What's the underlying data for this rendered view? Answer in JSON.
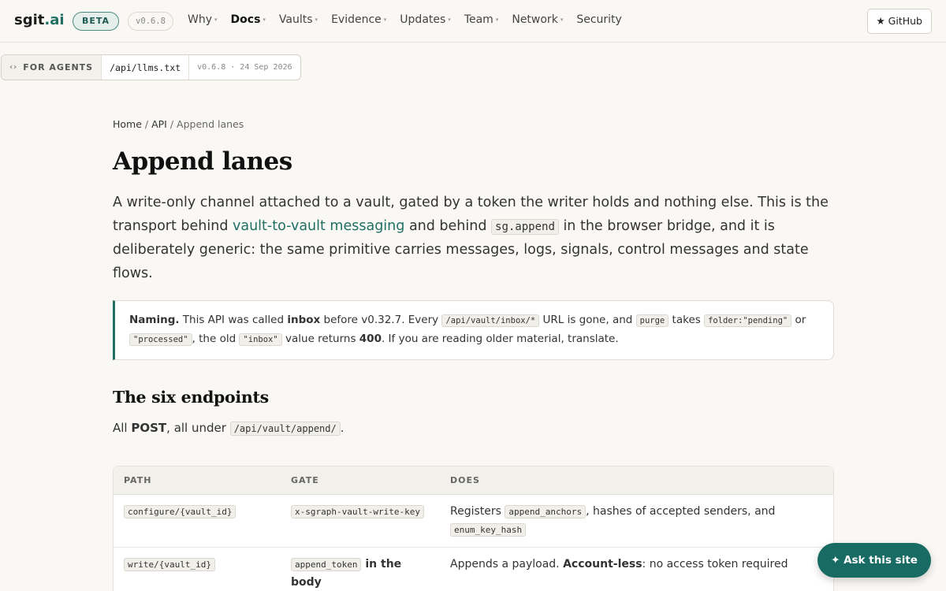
{
  "header": {
    "logo_main": "sgit",
    "logo_tld": ".ai",
    "beta": "BETA",
    "version": "v0.6.8",
    "nav": [
      {
        "label": "Why",
        "caret": "▾"
      },
      {
        "label": "Docs",
        "caret": "▾"
      },
      {
        "label": "Vaults",
        "caret": "▾"
      },
      {
        "label": "Evidence",
        "caret": "▾"
      },
      {
        "label": "Updates",
        "caret": "▾"
      },
      {
        "label": "Team",
        "caret": "▾"
      },
      {
        "label": "Network",
        "caret": "▾"
      },
      {
        "label": "Security",
        "caret": ""
      }
    ],
    "github": "★ GitHub"
  },
  "agents": {
    "chevron": "‹›",
    "label": "FOR AGENTS",
    "path": "/api/llms.txt",
    "meta": "v0.6.8 · 24 Sep 2026"
  },
  "breadcrumb": {
    "home": "Home",
    "sep1": " / ",
    "api": "API",
    "sep2": " / ",
    "current": "Append lanes"
  },
  "title": "Append lanes",
  "lead": {
    "p1": "A write-only channel attached to a vault, gated by a token the writer holds and nothing else. This is the transport behind ",
    "link": "vault-to-vault messaging",
    "p2": " and behind ",
    "code": "sg.append",
    "p3": " in the browser bridge, and it is deliberately generic: the same primitive carries messages, logs, signals, control messages and state flows."
  },
  "callout": {
    "lead": "Naming.",
    "t1": " This API was called ",
    "b1": "inbox",
    "t2": " before v0.32.7. Every ",
    "c1": "/api/vault/inbox/*",
    "t3": " URL is gone, and ",
    "c2": "purge",
    "t4": " takes ",
    "c3": "folder:\"pending\"",
    "t5": " or ",
    "c4": "\"processed\"",
    "t6": ", the old ",
    "c5": "\"inbox\"",
    "t7": " value returns ",
    "b2": "400",
    "t8": ". If you are reading older material, translate."
  },
  "section": {
    "heading": "The six endpoints",
    "t1": "All ",
    "b1": "POST",
    "t2": ", all under ",
    "c1": "/api/vault/append/",
    "t3": "."
  },
  "table": {
    "headers": [
      "PATH",
      "GATE",
      "DOES"
    ],
    "rows": [
      {
        "path": "configure/{vault_id}",
        "gate_code": "x-sgraph-vault-write-key",
        "gate_text": "",
        "does_t1": "Registers ",
        "does_c1": "append_anchors",
        "does_t2": ", hashes of accepted senders, and ",
        "does_c2": "enum_key_hash",
        "does_b1": "",
        "does_t3": ""
      },
      {
        "path": "write/{vault_id}",
        "gate_code": "append_token",
        "gate_text": " in the body",
        "does_t1": "Appends a payload. ",
        "does_c1": "",
        "does_t2": "",
        "does_c2": "",
        "does_b1": "Account-less",
        "does_t3": ": no access token required"
      }
    ]
  },
  "ask": "✦ Ask this site"
}
